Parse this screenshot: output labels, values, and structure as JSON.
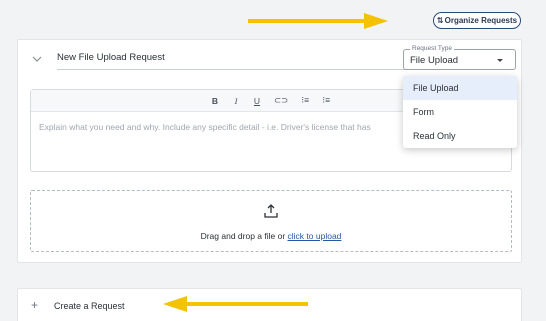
{
  "organize_button": {
    "icon": "sort-icon",
    "icon_glyph": "⇅",
    "label": "Organize Requests"
  },
  "request": {
    "title_value": "New File Upload Request",
    "request_type": {
      "legend": "Request Type",
      "selected": "File Upload",
      "options": [
        "File Upload",
        "Form",
        "Read Only"
      ]
    },
    "toolbar": {
      "bold": "B",
      "italic": "I",
      "underline": "U",
      "link": "⊂⊃",
      "ordered_list": "⁝≡",
      "bullet_list": "⁝≡"
    },
    "description_placeholder": "Explain what you need and why. Include any specific detail - i.e. Driver's license that has",
    "dropzone": {
      "text": "Drag and drop a file or ",
      "link": "click to upload"
    }
  },
  "create_request": {
    "icon_glyph": "+",
    "label": "Create a Request"
  },
  "colors": {
    "arrow": "#f5c200",
    "accent": "#2456a6",
    "selected_option_bg": "#e6eefb"
  }
}
